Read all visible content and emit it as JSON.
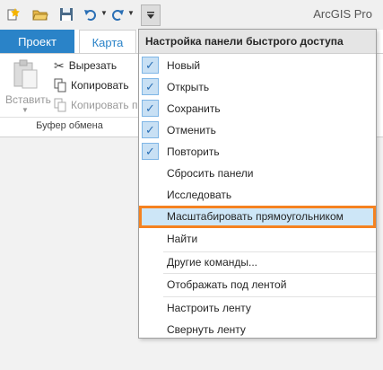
{
  "app_title": "ArcGIS Pro",
  "tabs": {
    "project": "Проект",
    "map": "Карта"
  },
  "clipboard": {
    "paste": "Вставить",
    "cut": "Вырезать",
    "copy": "Копировать",
    "copy_path": "Копировать п",
    "group_label": "Буфер обмена"
  },
  "menu": {
    "title": "Настройка панели быстрого доступа",
    "checked_items": [
      "Новый",
      "Открыть",
      "Сохранить",
      "Отменить",
      "Повторить"
    ],
    "check_glyph": "✓",
    "items": {
      "reset": "Сбросить панели",
      "explore": "Исследовать",
      "zoom_rect": "Масштабировать прямоугольником",
      "find": "Найти",
      "more_commands": "Другие команды...",
      "show_below": "Отображать под лентой",
      "customize_ribbon": "Настроить ленту",
      "minimize_ribbon": "Свернуть ленту"
    }
  },
  "colors": {
    "accent": "#2a83c8",
    "highlight_border": "#f58220",
    "highlight_fill": "#cde6f7"
  }
}
